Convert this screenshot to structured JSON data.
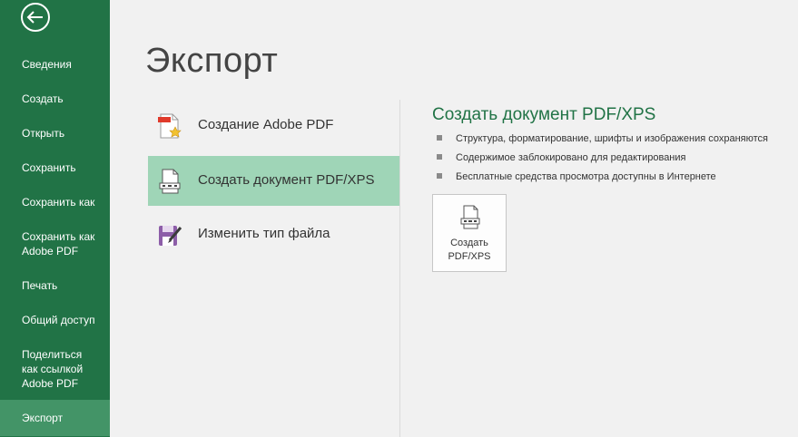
{
  "sidebar": {
    "items": [
      {
        "label": "Сведения"
      },
      {
        "label": "Создать"
      },
      {
        "label": "Открыть"
      },
      {
        "label": "Сохранить"
      },
      {
        "label": "Сохранить как"
      },
      {
        "label": "Сохранить как\nAdobe PDF"
      },
      {
        "label": "Печать"
      },
      {
        "label": "Общий доступ"
      },
      {
        "label": "Поделиться\nкак ссылкой\nAdobe PDF"
      },
      {
        "label": "Экспорт"
      }
    ],
    "active_index": 9,
    "background": "#217346",
    "active_background": "#439467"
  },
  "main": {
    "title": "Экспорт",
    "options": [
      {
        "label": "Создание Adobe PDF",
        "icon": "adobe-pdf-icon"
      },
      {
        "label": "Создать документ PDF/XPS",
        "icon": "pdf-xps-document-icon"
      },
      {
        "label": "Изменить тип файла",
        "icon": "change-file-type-icon"
      }
    ],
    "selected_index": 1
  },
  "detail": {
    "title": "Создать документ PDF/XPS",
    "bullets": [
      "Структура, форматирование, шрифты и изображения сохраняются",
      "Содержимое заблокировано для редактирования",
      "Бесплатные средства просмотра доступны в Интернете"
    ],
    "button_label": "Создать\nPDF/XPS",
    "accent": "#217346"
  }
}
